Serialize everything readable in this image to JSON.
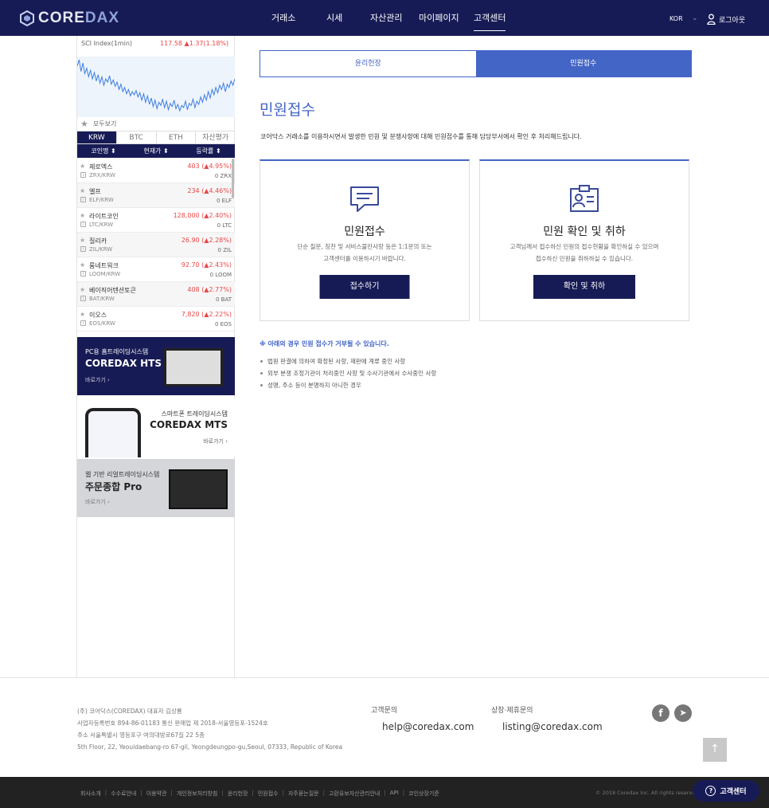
{
  "brand": {
    "name_a": "CORE",
    "name_b": "DAX"
  },
  "nav": {
    "items": [
      "거래소",
      "시세",
      "자산관리",
      "마이페이지",
      "고객센터"
    ],
    "active_index": 4,
    "lang": "KOR",
    "logout": "로그아웃"
  },
  "sidebar": {
    "index_label": "SCI Index(1min)",
    "index_value": "117.58 ▲1.37(1.18%)",
    "favorites_label": "모두보기",
    "market_tabs": [
      "KRW",
      "BTC",
      "ETH",
      "자산평가"
    ],
    "columns": [
      "코인명 ⬍",
      "현재가 ⬍",
      "등락률 ⬍"
    ],
    "coins": [
      {
        "name": "제로엑스",
        "pair": "ZRX/KRW",
        "price": "403 (▲4.95%)",
        "volume": "0 ZRX"
      },
      {
        "name": "엘프",
        "pair": "ELF/KRW",
        "price": "234 (▲4.46%)",
        "volume": "0 ELF"
      },
      {
        "name": "라이트코인",
        "pair": "LTC/KRW",
        "price": "128,000 (▲2.40%)",
        "volume": "0 LTC"
      },
      {
        "name": "질리카",
        "pair": "ZIL/KRW",
        "price": "26.90 (▲2.28%)",
        "volume": "0 ZIL"
      },
      {
        "name": "룸네트워크",
        "pair": "LOOM/KRW",
        "price": "92.70 (▲2.43%)",
        "volume": "0 LOOM"
      },
      {
        "name": "베이직어텐션토큰",
        "pair": "BAT/KRW",
        "price": "408 (▲2.77%)",
        "volume": "0 BAT"
      },
      {
        "name": "이오스",
        "pair": "EOS/KRW",
        "price": "7,820 (▲2.22%)",
        "volume": "0 EOS"
      }
    ],
    "banner_hts": {
      "sub": "PC용 홈트레이딩시스템",
      "title": "COREDAX HTS",
      "more": "바로가기 ›"
    },
    "banner_mts": {
      "sub": "스마트폰 트레이딩시스템",
      "title": "COREDAX MTS",
      "more": "바로가기 ›"
    },
    "banner_pro": {
      "sub": "웹 기반 리얼트레이딩시스템",
      "title": "주문종합 Pro",
      "more": "바로가기 ›"
    }
  },
  "content": {
    "tabs": [
      "윤리헌장",
      "민원접수"
    ],
    "active_tab": 1,
    "title": "민원접수",
    "description": "코어닥스 거래소를 이용하시면서 발생한 민원 및 분쟁사항에 대해 민원접수를 통해 담당부서에서 확인 후 처리해드립니다.",
    "card1": {
      "title": "민원접수",
      "desc1": "단순 질문, 칭찬 및 서비스불만사항 등은 1:1문의 또는",
      "desc2": "고객센터를 이용하시기 바랍니다.",
      "button": "접수하기"
    },
    "card2": {
      "title": "민원 확인 및 취하",
      "desc1": "고객님께서 접수하신 민원의 접수현황을 확인하실 수 있으며",
      "desc2": "접수하신 민원을 취하하실 수 있습니다.",
      "button": "확인 및 취하"
    },
    "notice_title": "※ 아래의 경우 민원 접수가 거부될 수 있습니다.",
    "notices": [
      "법원 판결에 의하여 확정된 사항, 재판에 계류 중인 사항",
      "외부 분쟁 조정기관이 처리중인 사항 및 수사기관에서 수사중인 사항",
      "성명, 주소 등이 분명하지 아니한 경우"
    ]
  },
  "footer": {
    "company_lines": [
      "(주) 코어닥스(COREDAX)     대표자 김상룡",
      "사업자등록번호 894-86-01183    통신 판매업 제 2018-서울영등포-1524호",
      "주소 서울특별시 영등포구 여의대방로67길 22 5층",
      "5th Floor, 22, Yeouidaebang-ro 67-gil, Yeongdeungpo-gu,Seoul, 07333, Republic of Korea"
    ],
    "support_label": "고객문의",
    "support_email": "help@coredax.com",
    "listing_label": "상장·제휴문의",
    "listing_email": "listing@coredax.com",
    "bottom_links": [
      "회사소개",
      "수수료안내",
      "이용약관",
      "개인정보처리방침",
      "윤리헌장",
      "민원접수",
      "자주묻는질문",
      "고환유보자산관리안내",
      "API",
      "코인상장기준"
    ],
    "copyright": "© 2018 Coredax Inc. All rights reserved.",
    "cs_button": "고객센터"
  },
  "chart_data": {
    "type": "line",
    "title": "SCI Index(1min)",
    "values": [
      62,
      68,
      57,
      65,
      55,
      60,
      52,
      58,
      50,
      56,
      48,
      54,
      46,
      52,
      44,
      50,
      47,
      53,
      45,
      49,
      43,
      47,
      40,
      45,
      38,
      42,
      36,
      40,
      34,
      38,
      35,
      39,
      33,
      37,
      30,
      36,
      28,
      34,
      26,
      32,
      24,
      30,
      22,
      28,
      25,
      31,
      23,
      29,
      21,
      27,
      24,
      30,
      22,
      26,
      20,
      25,
      23,
      29,
      21,
      27,
      25,
      31,
      23,
      29,
      26,
      33,
      28,
      35,
      30,
      38,
      32,
      40,
      35,
      42,
      37,
      44,
      40,
      46,
      38,
      45,
      42,
      48,
      44,
      50
    ]
  }
}
